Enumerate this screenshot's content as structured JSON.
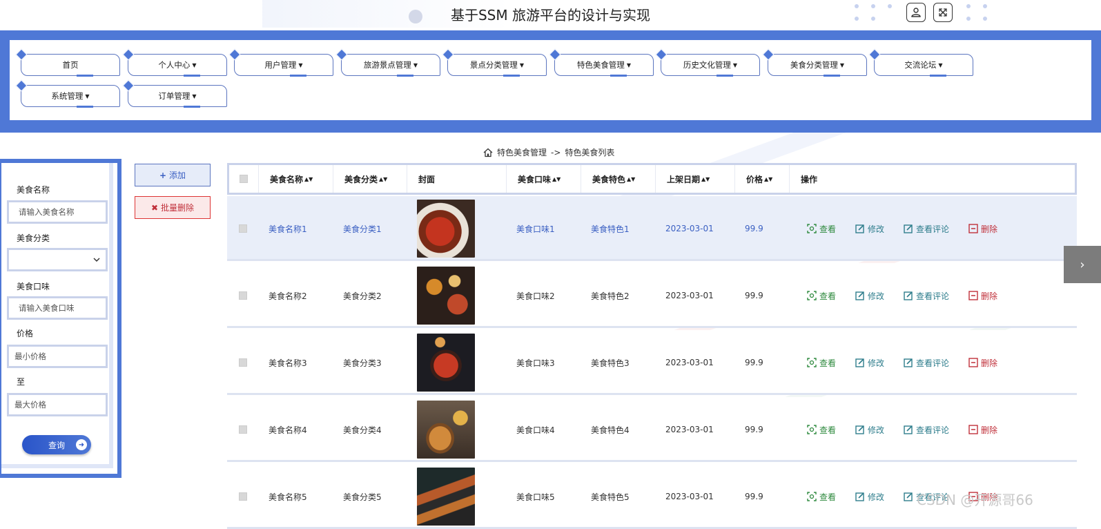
{
  "header": {
    "title": "基于SSM 旅游平台的设计与实现"
  },
  "nav": [
    {
      "label": "首页",
      "dropdown": false
    },
    {
      "label": "个人中心",
      "dropdown": true
    },
    {
      "label": "用户管理",
      "dropdown": true
    },
    {
      "label": "旅游景点管理",
      "dropdown": true
    },
    {
      "label": "景点分类管理",
      "dropdown": true
    },
    {
      "label": "特色美食管理",
      "dropdown": true
    },
    {
      "label": "历史文化管理",
      "dropdown": true
    },
    {
      "label": "美食分类管理",
      "dropdown": true
    },
    {
      "label": "交流论坛",
      "dropdown": true
    },
    {
      "label": "系统管理",
      "dropdown": true
    },
    {
      "label": "订单管理",
      "dropdown": true
    }
  ],
  "breadcrumb": {
    "parent": "特色美食管理",
    "separator": "->",
    "current": "特色美食列表"
  },
  "search": {
    "name_label": "美食名称",
    "name_placeholder": "请输入美食名称",
    "category_label": "美食分类",
    "taste_label": "美食口味",
    "taste_placeholder": "请输入美食口味",
    "price_label": "价格",
    "price_min_placeholder": "最小价格",
    "to_label": "至",
    "price_max_placeholder": "最大价格",
    "query_label": "查询"
  },
  "actions": {
    "add_label": "添加",
    "batch_delete_label": "批量删除"
  },
  "table": {
    "headers": {
      "name": "美食名称",
      "category": "美食分类",
      "cover": "封面",
      "taste": "美食口味",
      "feature": "美食特色",
      "date": "上架日期",
      "price": "价格",
      "ops": "操作"
    },
    "op_labels": {
      "view": "查看",
      "edit": "修改",
      "comments": "查看评论",
      "delete": "删除"
    },
    "rows": [
      {
        "name": "美食名称1",
        "category": "美食分类1",
        "taste": "美食口味1",
        "feature": "美食特色1",
        "date": "2023-03-01",
        "price": "99.9"
      },
      {
        "name": "美食名称2",
        "category": "美食分类2",
        "taste": "美食口味2",
        "feature": "美食特色2",
        "date": "2023-03-01",
        "price": "99.9"
      },
      {
        "name": "美食名称3",
        "category": "美食分类3",
        "taste": "美食口味3",
        "feature": "美食特色3",
        "date": "2023-03-01",
        "price": "99.9"
      },
      {
        "name": "美食名称4",
        "category": "美食分类4",
        "taste": "美食口味4",
        "feature": "美食特色4",
        "date": "2023-03-01",
        "price": "99.9"
      },
      {
        "name": "美食名称5",
        "category": "美食分类5",
        "taste": "美食口味5",
        "feature": "美食特色5",
        "date": "2023-03-01",
        "price": "99.9"
      }
    ]
  },
  "watermark": "CSDN @开源哥66",
  "colors": {
    "primary": "#4f78d6",
    "view": "#2f8a3f",
    "edit": "#2e7d8c",
    "delete": "#c0303a"
  }
}
